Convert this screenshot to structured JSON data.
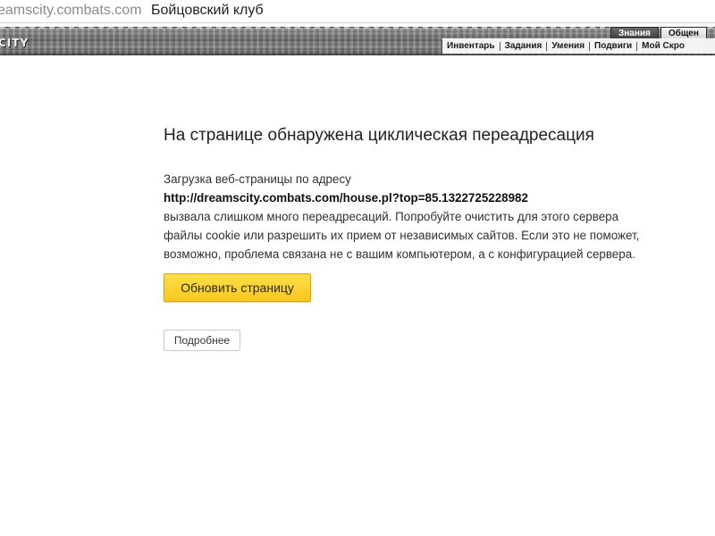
{
  "window": {
    "url": "eamscity.combats.com",
    "title": "Бойцовский клуб"
  },
  "game_header": {
    "logo": "CITY",
    "top_tabs": [
      "Знания",
      "Общен"
    ],
    "menu": [
      "Инвентарь",
      "Задания",
      "Умения",
      "Подвиги",
      "Мой Скро"
    ]
  },
  "error": {
    "heading": "На странице обнаружена циклическая переадресация",
    "line1": "Загрузка веб-страницы по адресу",
    "url": "http://dreamscity.combats.com/house.pl?top=85.1322725228982",
    "line3": "вызвала слишком много переадресаций. Попробуйте очистить для этого сервера",
    "line4": "файлы cookie или разрешить их прием от независимых сайтов. Если это не поможет,",
    "line5": "возможно, проблема связана не с вашим компьютером, а с конфигурацией сервера.",
    "reload_label": "Обновить страницу",
    "details_label": "Подробнее"
  },
  "colors": {
    "reload_button": "#f8c71c",
    "heading_text": "#222222"
  }
}
